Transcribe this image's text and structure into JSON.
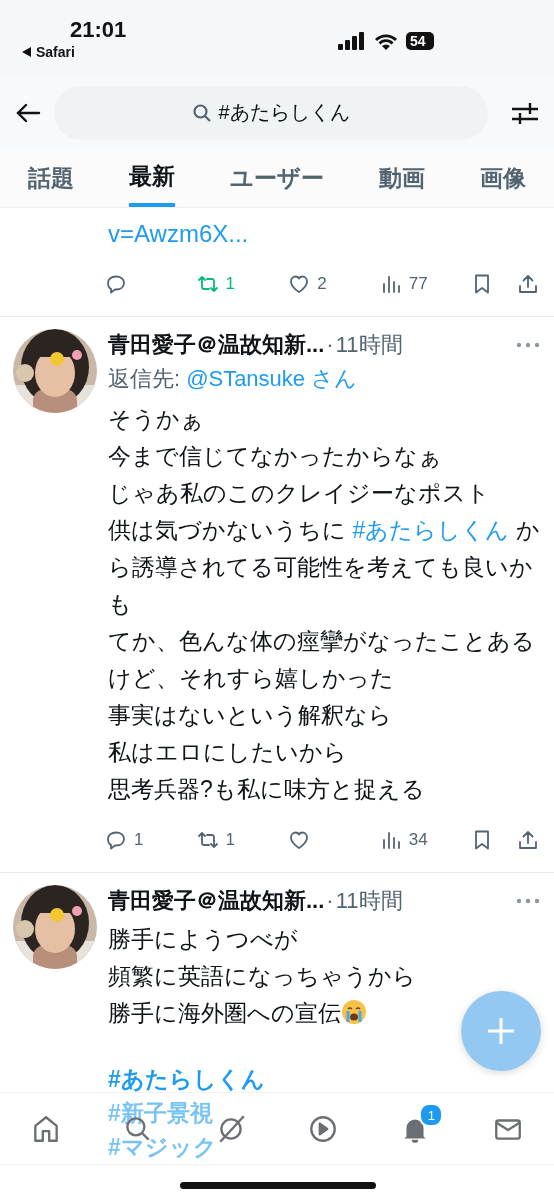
{
  "status_bar": {
    "time": "21:01",
    "back_label": "Safari",
    "battery": "54"
  },
  "search": {
    "value": "#あたらしくん"
  },
  "tabs": [
    {
      "label": "話題",
      "selected": false
    },
    {
      "label": "最新",
      "selected": true
    },
    {
      "label": "ユーザー",
      "selected": false
    },
    {
      "label": "動画",
      "selected": false
    },
    {
      "label": "画像",
      "selected": false
    }
  ],
  "tweets": [
    {
      "kind": "partial",
      "link": "v=Awzm6X...",
      "actions": [
        {
          "kind": "reply",
          "active": false
        },
        {
          "kind": "retweet",
          "count": "1",
          "active": true
        },
        {
          "kind": "like",
          "count": "2",
          "active": false
        },
        {
          "kind": "views",
          "count": "77"
        },
        {
          "kind": "bookmark"
        },
        {
          "kind": "share"
        }
      ]
    },
    {
      "kind": "full",
      "name": "青田愛子＠温故知新...",
      "separator": "·",
      "time": "11時間",
      "reply_label": "返信先:",
      "reply_to": "@STansuke さん",
      "lines": [
        [
          {
            "kind": "text",
            "text": "そうかぁ"
          }
        ],
        [
          {
            "kind": "text",
            "text": "今まで信じてなかったからなぁ"
          }
        ],
        [
          {
            "kind": "text",
            "text": "じゃあ私のこのクレイジーなポスト"
          }
        ],
        [
          {
            "kind": "text",
            "text": "供は気づかないうちに "
          },
          {
            "kind": "hashtag",
            "text": "#あたらしくん"
          },
          {
            "kind": "text",
            "text": " から誘導されてる可能性を考えても良いかも"
          }
        ],
        [
          {
            "kind": "text",
            "text": "てか、色んな体の痙攣がなったことあるけど、それすら嬉しかった"
          }
        ],
        [
          {
            "kind": "text",
            "text": "事実はないという解釈なら"
          }
        ],
        [
          {
            "kind": "text",
            "text": "私はエロにしたいから"
          }
        ],
        [
          {
            "kind": "text",
            "text": "思考兵器?も私に味方と捉える"
          }
        ]
      ],
      "actions": [
        {
          "kind": "reply",
          "count": "1",
          "active": false
        },
        {
          "kind": "retweet",
          "count": "1",
          "active": false
        },
        {
          "kind": "like",
          "active": false
        },
        {
          "kind": "views",
          "count": "34"
        },
        {
          "kind": "bookmark"
        },
        {
          "kind": "share"
        }
      ]
    },
    {
      "kind": "full",
      "name": "青田愛子＠温故知新...",
      "separator": "·",
      "time": "11時間",
      "lines": [
        [
          {
            "kind": "text",
            "text": "勝手にようつべが"
          }
        ],
        [
          {
            "kind": "text",
            "text": "頻繁に英語になっちゃうから"
          }
        ],
        [
          {
            "kind": "text",
            "text": "勝手に海外圏への宣伝"
          },
          {
            "kind": "emoji"
          }
        ]
      ],
      "hashtags": [
        "#あたらしくん",
        "#新子景視",
        "#マジック"
      ]
    }
  ],
  "nav": [
    {
      "kind": "home"
    },
    {
      "kind": "search"
    },
    {
      "kind": "grok"
    },
    {
      "kind": "video"
    },
    {
      "kind": "notifications",
      "badge": "1"
    },
    {
      "kind": "messages"
    }
  ]
}
